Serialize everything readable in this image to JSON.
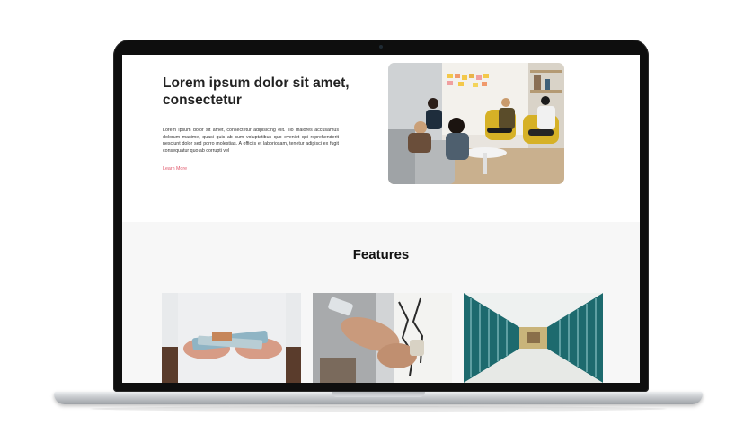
{
  "hero": {
    "title": "Lorem ipsum dolor sit amet, consectetur",
    "body": "Lorem ipsum dolor sit amet, consectetur adipisicing elit. Illo maiores accusamus dolorum maxime, quasi quis ab cum voluptatibus quo eveniet qui reprehenderit nesciunt dolor sed porro molestias. A officiis et laboriosam, tenetur adipisci ex fugit consequatur quo ab corrupti vel",
    "link_label": "Learn More"
  },
  "features": {
    "title": "Features"
  },
  "colors": {
    "accent_link": "#e0566a",
    "features_bg": "#f7f7f7"
  }
}
